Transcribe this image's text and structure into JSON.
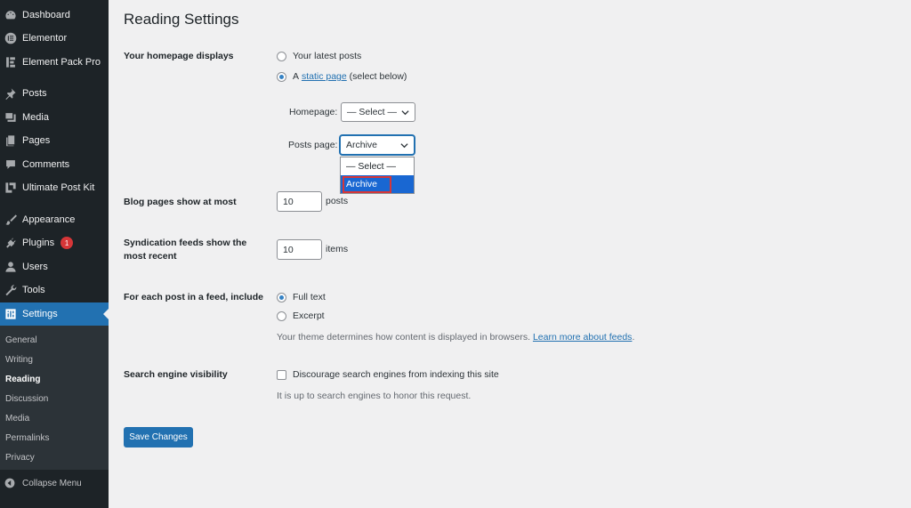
{
  "sidebar": {
    "items": [
      {
        "label": "Dashboard",
        "icon": "dashboard-icon"
      },
      {
        "label": "Elementor",
        "icon": "elementor-icon"
      },
      {
        "label": "Element Pack Pro",
        "icon": "element-pack-icon"
      },
      {
        "label": "Posts",
        "icon": "pin-icon"
      },
      {
        "label": "Media",
        "icon": "media-icon"
      },
      {
        "label": "Pages",
        "icon": "pages-icon"
      },
      {
        "label": "Comments",
        "icon": "comments-icon"
      },
      {
        "label": "Ultimate Post Kit",
        "icon": "post-kit-icon"
      },
      {
        "label": "Appearance",
        "icon": "brush-icon"
      },
      {
        "label": "Plugins",
        "icon": "plugin-icon",
        "badge": "1"
      },
      {
        "label": "Users",
        "icon": "users-icon"
      },
      {
        "label": "Tools",
        "icon": "wrench-icon"
      },
      {
        "label": "Settings",
        "icon": "settings-icon",
        "active": true
      }
    ],
    "submenu": [
      "General",
      "Writing",
      "Reading",
      "Discussion",
      "Media",
      "Permalinks",
      "Privacy"
    ],
    "submenu_current": "Reading",
    "collapse_label": "Collapse Menu"
  },
  "page": {
    "title": "Reading Settings",
    "homepage_displays": {
      "label": "Your homepage displays",
      "option_latest": "Your latest posts",
      "option_static_prefix": "A",
      "option_static_link": "static page",
      "option_static_suffix": "(select below)",
      "selected": "static"
    },
    "homepage_select": {
      "label": "Homepage:",
      "value": "— Select —"
    },
    "posts_page_select": {
      "label": "Posts page:",
      "value": "Archive",
      "options": [
        "— Select —",
        "Archive"
      ],
      "highlighted": "Archive"
    },
    "blog_pages": {
      "label": "Blog pages show at most",
      "value": "10",
      "unit": "posts"
    },
    "syndication": {
      "label_line1": "Syndication feeds show the",
      "label_line2": "most recent",
      "value": "10",
      "unit": "items"
    },
    "feed_include": {
      "label": "For each post in a feed, include",
      "option_full": "Full text",
      "option_excerpt": "Excerpt",
      "selected": "full",
      "desc_prefix": "Your theme determines how content is displayed in browsers.",
      "desc_link": "Learn more about feeds",
      "desc_suffix": "."
    },
    "search_visibility": {
      "label": "Search engine visibility",
      "checkbox_label": "Discourage search engines from indexing this site",
      "checked": false,
      "desc": "It is up to search engines to honor this request."
    },
    "save_label": "Save Changes"
  },
  "colors": {
    "sidebar_bg": "#1d2327",
    "accent": "#2271b1",
    "badge": "#d63638",
    "highlight": "#1967d2"
  }
}
